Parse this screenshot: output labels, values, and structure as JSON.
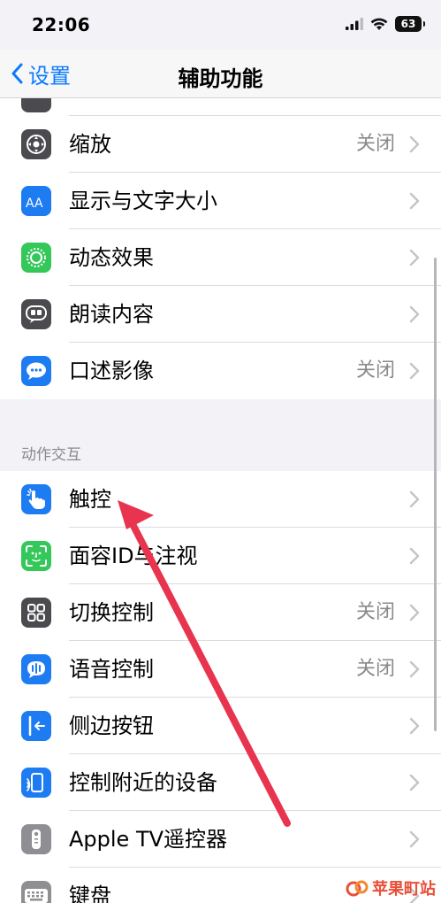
{
  "status_bar": {
    "time": "22:06",
    "battery": "63"
  },
  "nav": {
    "back_label": "设置",
    "title": "辅助功能"
  },
  "group_top": [
    {
      "name": "zoom",
      "label": "缩放",
      "value": "关闭",
      "icon": "zoom-icon",
      "color": "#4a4a4f"
    },
    {
      "name": "display-text-size",
      "label": "显示与文字大小",
      "value": "",
      "icon": "text-size-icon",
      "color": "#1e7cf2"
    },
    {
      "name": "motion",
      "label": "动态效果",
      "value": "",
      "icon": "motion-icon",
      "color": "#34c759"
    },
    {
      "name": "spoken-content",
      "label": "朗读内容",
      "value": "",
      "icon": "speech-bubble-icon",
      "color": "#4a4a4f"
    },
    {
      "name": "audio-descriptions",
      "label": "口述影像",
      "value": "关闭",
      "icon": "chat-bubble-icon",
      "color": "#1e7cf2"
    }
  ],
  "section_header": "动作交互",
  "group_interaction": [
    {
      "name": "touch",
      "label": "触控",
      "value": "",
      "icon": "hand-tap-icon",
      "color": "#1e7cf2"
    },
    {
      "name": "face-id-attention",
      "label": "面容ID与注视",
      "value": "",
      "icon": "face-id-icon",
      "color": "#34c759"
    },
    {
      "name": "switch-control",
      "label": "切换控制",
      "value": "关闭",
      "icon": "grid-icon",
      "color": "#4a4a4f"
    },
    {
      "name": "voice-control",
      "label": "语音控制",
      "value": "关闭",
      "icon": "voice-control-icon",
      "color": "#1e7cf2"
    },
    {
      "name": "side-button",
      "label": "侧边按钮",
      "value": "",
      "icon": "side-button-icon",
      "color": "#1e7cf2"
    },
    {
      "name": "control-nearby-devices",
      "label": "控制附近的设备",
      "value": "",
      "icon": "nearby-devices-icon",
      "color": "#1e7cf2"
    },
    {
      "name": "apple-tv-remote",
      "label": "Apple TV遥控器",
      "value": "",
      "icon": "remote-icon",
      "color": "#8e8e93"
    },
    {
      "name": "keyboards",
      "label": "键盘",
      "value": "",
      "icon": "keyboard-icon",
      "color": "#8e8e93"
    }
  ],
  "watermark": "苹果町站",
  "colors": {
    "accent": "#0a7aff",
    "arrow": "#e8344e"
  }
}
